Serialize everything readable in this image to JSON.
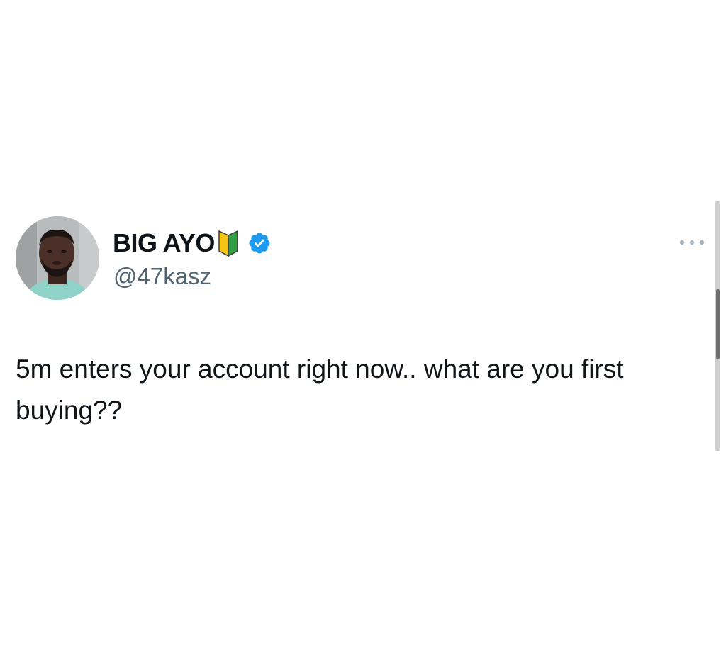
{
  "tweet": {
    "display_name": "BIG AYO",
    "handle": "@47kasz",
    "text": "5m enters your account right now.. what are you first buying??",
    "icons": {
      "avatar": "profile-photo",
      "name_emoji": "japanese-beginner-symbol-icon",
      "verified": "verified-badge-icon",
      "more": "more-options-icon"
    },
    "colors": {
      "name": "#0f1419",
      "handle": "#536471",
      "text": "#0f1419",
      "verified": "#1d9bf0",
      "more": "#aab8c2"
    }
  }
}
